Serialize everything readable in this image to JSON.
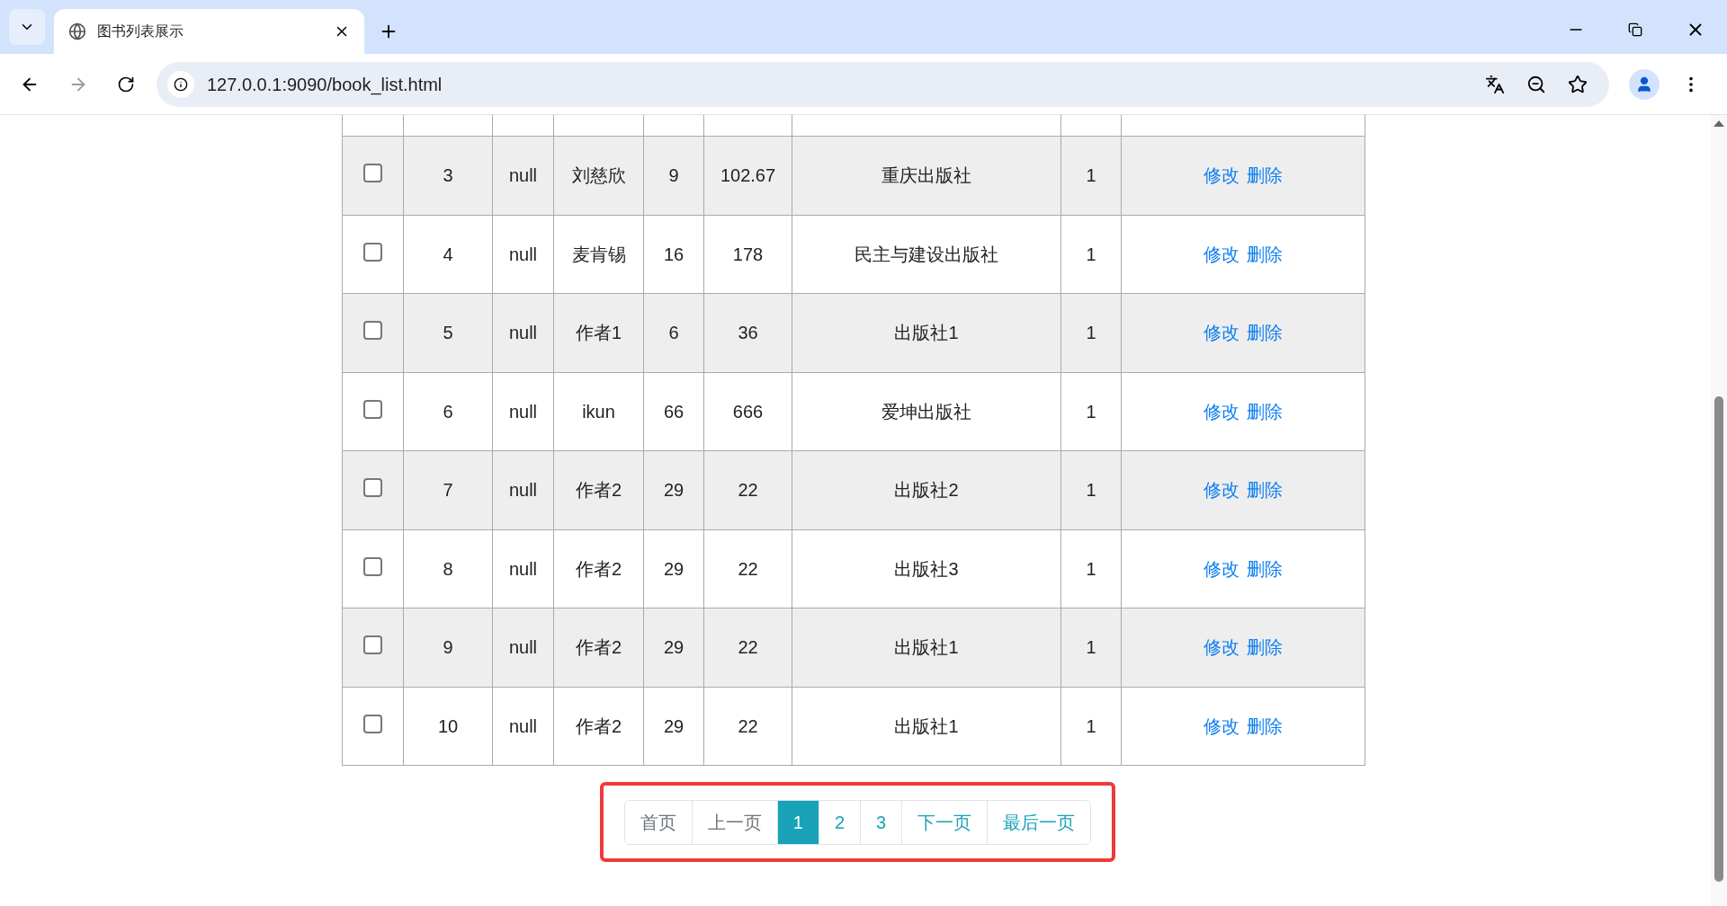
{
  "browser": {
    "tab_title": "图书列表展示",
    "url": "127.0.0.1:9090/book_list.html"
  },
  "table": {
    "rows": [
      {
        "checked": false,
        "cells": [
          "3",
          "null",
          "刘慈欣",
          "9",
          "102.67",
          "重庆出版社",
          "1"
        ],
        "actions": [
          "修改",
          "删除"
        ]
      },
      {
        "checked": false,
        "cells": [
          "4",
          "null",
          "麦肯锡",
          "16",
          "178",
          "民主与建设出版社",
          "1"
        ],
        "actions": [
          "修改",
          "删除"
        ]
      },
      {
        "checked": false,
        "cells": [
          "5",
          "null",
          "作者1",
          "6",
          "36",
          "出版社1",
          "1"
        ],
        "actions": [
          "修改",
          "删除"
        ]
      },
      {
        "checked": false,
        "cells": [
          "6",
          "null",
          "ikun",
          "66",
          "666",
          "爱坤出版社",
          "1"
        ],
        "actions": [
          "修改",
          "删除"
        ]
      },
      {
        "checked": false,
        "cells": [
          "7",
          "null",
          "作者2",
          "29",
          "22",
          "出版社2",
          "1"
        ],
        "actions": [
          "修改",
          "删除"
        ]
      },
      {
        "checked": false,
        "cells": [
          "8",
          "null",
          "作者2",
          "29",
          "22",
          "出版社3",
          "1"
        ],
        "actions": [
          "修改",
          "删除"
        ]
      },
      {
        "checked": false,
        "cells": [
          "9",
          "null",
          "作者2",
          "29",
          "22",
          "出版社1",
          "1"
        ],
        "actions": [
          "修改",
          "删除"
        ]
      },
      {
        "checked": false,
        "cells": [
          "10",
          "null",
          "作者2",
          "29",
          "22",
          "出版社1",
          "1"
        ],
        "actions": [
          "修改",
          "删除"
        ]
      }
    ]
  },
  "pagination": [
    {
      "label": "首页",
      "selected": false,
      "disabled": true
    },
    {
      "label": "上一页",
      "selected": false,
      "disabled": true
    },
    {
      "label": "1",
      "selected": true,
      "disabled": false
    },
    {
      "label": "2",
      "selected": false,
      "disabled": false
    },
    {
      "label": "3",
      "selected": false,
      "disabled": false
    },
    {
      "label": "下一页",
      "selected": false,
      "disabled": false
    },
    {
      "label": "最后一页",
      "selected": false,
      "disabled": false
    }
  ]
}
